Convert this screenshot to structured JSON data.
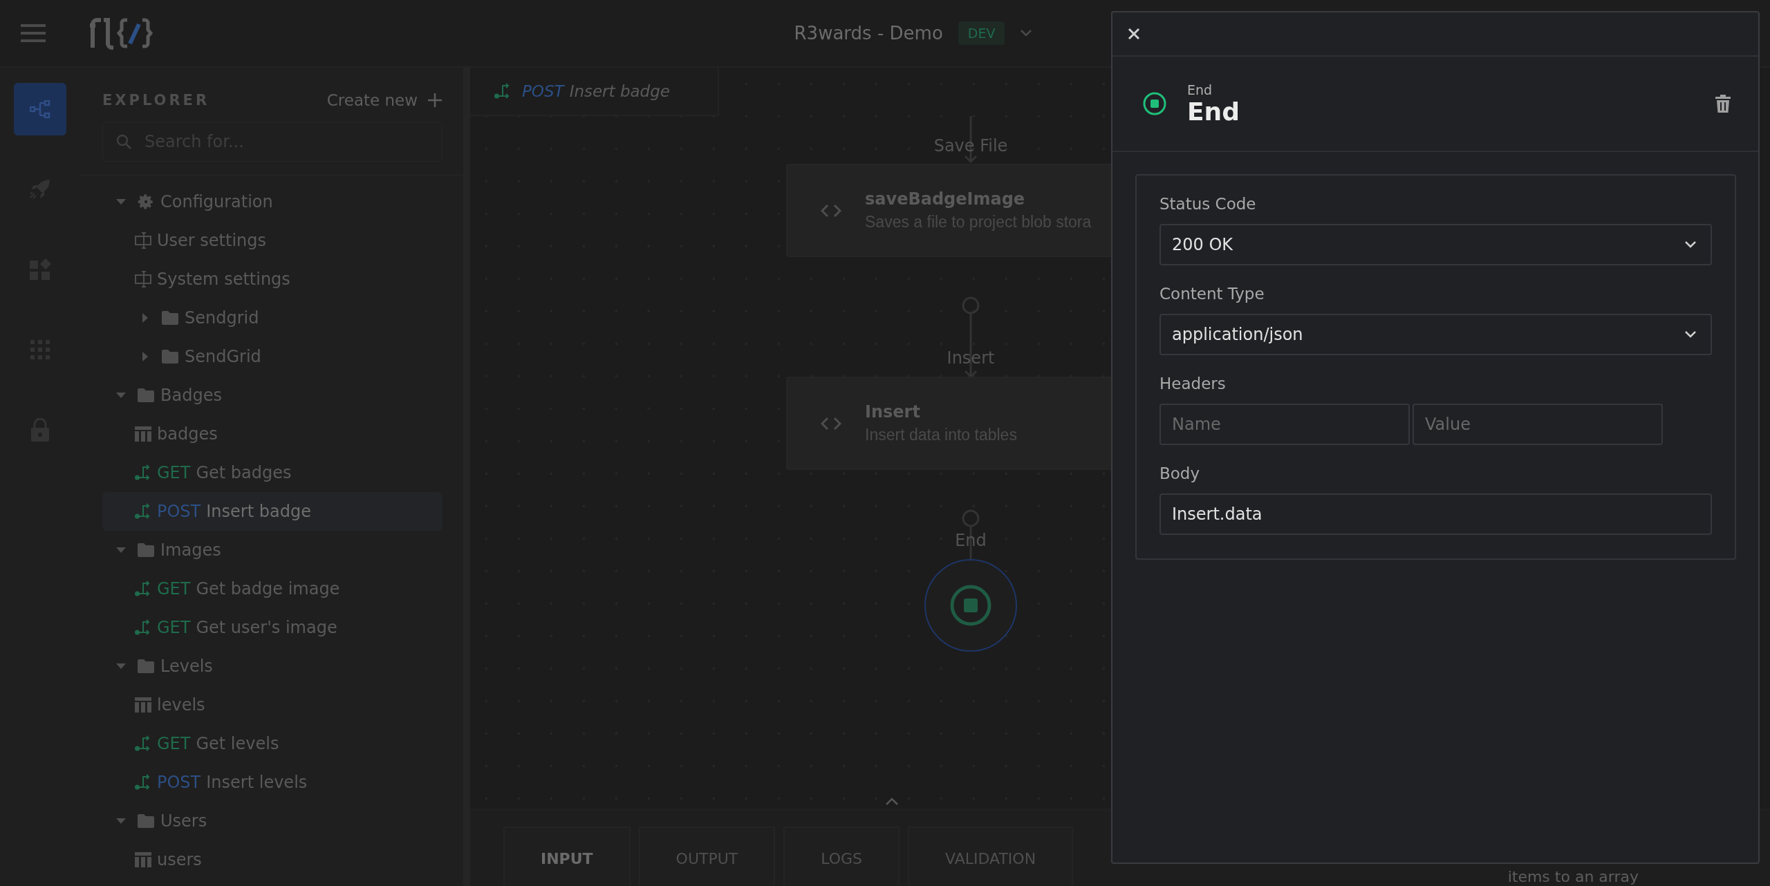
{
  "header": {
    "title": "R3wards - Demo",
    "env_badge": "DEV"
  },
  "rail": [
    {
      "selected": true
    },
    {
      "selected": false
    },
    {
      "selected": false
    },
    {
      "selected": false
    },
    {
      "selected": false
    }
  ],
  "explorer": {
    "title": "EXPLORER",
    "create_label": "Create new",
    "search_placeholder": "Search for...",
    "tree": [
      {
        "kind": "config",
        "label": "Configuration",
        "expanded": true,
        "children": [
          {
            "kind": "settings",
            "label": "User settings",
            "selected": false
          },
          {
            "kind": "settings",
            "label": "System settings",
            "selected": false
          },
          {
            "kind": "folder",
            "label": "Sendgrid",
            "expanded": false
          },
          {
            "kind": "folder",
            "label": "SendGrid",
            "expanded": false
          }
        ]
      },
      {
        "kind": "folder",
        "label": "Badges",
        "expanded": true,
        "children": [
          {
            "kind": "table",
            "label": "badges",
            "selected": false
          },
          {
            "kind": "endpoint",
            "method": "GET",
            "color": "#1f6b4c",
            "label": "Get badges",
            "selected": false
          },
          {
            "kind": "endpoint",
            "method": "POST",
            "color": "#2c4f85",
            "label": "Insert badge",
            "selected": true
          }
        ]
      },
      {
        "kind": "folder",
        "label": "Images",
        "expanded": true,
        "children": [
          {
            "kind": "endpoint",
            "method": "GET",
            "color": "#1f6b4c",
            "label": "Get badge image",
            "selected": false
          },
          {
            "kind": "endpoint",
            "method": "GET",
            "color": "#1f6b4c",
            "label": "Get user's image",
            "selected": false
          }
        ]
      },
      {
        "kind": "folder",
        "label": "Levels",
        "expanded": true,
        "children": [
          {
            "kind": "table",
            "label": "levels",
            "selected": false
          },
          {
            "kind": "endpoint",
            "method": "GET",
            "color": "#1f6b4c",
            "label": "Get levels",
            "selected": false
          },
          {
            "kind": "endpoint",
            "method": "POST",
            "color": "#2c4f85",
            "label": "Insert levels",
            "selected": false
          }
        ]
      },
      {
        "kind": "folder",
        "label": "Users",
        "expanded": true,
        "children": [
          {
            "kind": "table",
            "label": "users",
            "selected": false
          }
        ]
      }
    ]
  },
  "canvas": {
    "tab": {
      "method": "POST",
      "color": "#2c4f85",
      "label": "Insert badge"
    },
    "nodes": [
      {
        "kind": "step",
        "edge_label": "Save File",
        "title": "saveBadgeImage",
        "description": "Saves a file to project blob stora"
      },
      {
        "kind": "step",
        "edge_label": "Insert",
        "title": "Insert",
        "description": "Insert data into tables"
      },
      {
        "kind": "end",
        "edge_label": "End",
        "selected": true
      }
    ],
    "bottom_tabs": [
      {
        "label": "INPUT",
        "selected": true
      },
      {
        "label": "OUTPUT",
        "selected": false
      },
      {
        "label": "LOGS",
        "selected": false
      },
      {
        "label": "VALIDATION",
        "selected": false
      }
    ],
    "side_text": "items to an array"
  },
  "drawer": {
    "type_label": "End",
    "title": "End",
    "fields": [
      {
        "kind": "select",
        "label": "Status Code",
        "value": "200 OK"
      },
      {
        "kind": "select",
        "label": "Content Type",
        "value": "application/json"
      },
      {
        "kind": "pair",
        "label": "Headers",
        "placeholders": [
          "Name",
          "Value"
        ]
      },
      {
        "kind": "input",
        "label": "Body",
        "value": "Insert.data"
      }
    ]
  }
}
